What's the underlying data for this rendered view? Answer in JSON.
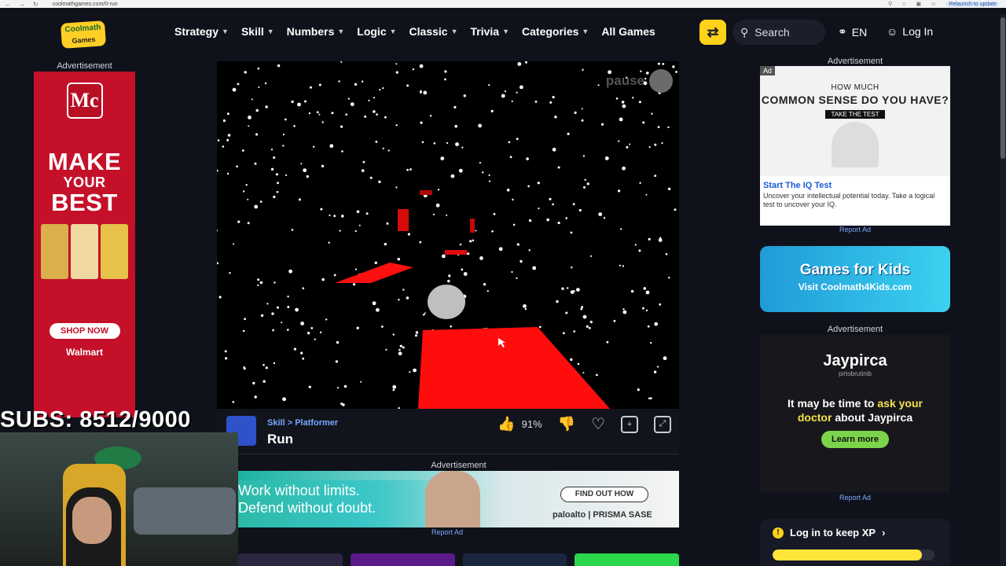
{
  "browser": {
    "url": "coolmathgames.com/0-run",
    "relaunch": "Relaunch to update"
  },
  "header": {
    "logo_line1": "Coolmath",
    "logo_line2": "Games",
    "menu": [
      {
        "label": "Strategy"
      },
      {
        "label": "Skill"
      },
      {
        "label": "Numbers"
      },
      {
        "label": "Logic"
      },
      {
        "label": "Classic"
      },
      {
        "label": "Trivia"
      },
      {
        "label": "Categories"
      }
    ],
    "all_games": "All Games",
    "search": "Search",
    "lang": "EN",
    "login": "Log In"
  },
  "left_ad": {
    "label": "Advertisement",
    "logo": "Mc",
    "headline_1": "MAKE",
    "headline_2": "YOUR",
    "headline_3": "BEST",
    "cta": "SHOP NOW",
    "retailer": "Walmart"
  },
  "overlay": {
    "subs": "SUBS: 8512/9000"
  },
  "game": {
    "pause": "pause",
    "breadcrumb_category": "Skill",
    "breadcrumb_sep": ">",
    "breadcrumb_sub": "Platformer",
    "title": "Run",
    "rating": "91%"
  },
  "mid_ad": {
    "label": "Advertisement",
    "line1": "Work without limits.",
    "line2": "Defend without doubt.",
    "cta": "FIND OUT HOW",
    "brand": "paloalto  |  PRISMA SASE",
    "report": "Report Ad"
  },
  "right_ad1": {
    "label": "Advertisement",
    "tag": "Ad",
    "h1": "HOW MUCH",
    "h2": "COMMON SENSE DO YOU HAVE?",
    "take": "TAKE THE TEST",
    "link": "Start The IQ Test",
    "desc": "Uncover your intellectual potential today. Take a logical test to uncover your IQ.",
    "report": "Report Ad"
  },
  "kids": {
    "title": "Games for Kids",
    "sub": "Visit Coolmath4Kids.com"
  },
  "right_ad2": {
    "label": "Advertisement",
    "brand": "Jaypirca",
    "brand_sub": "pirtobrutinib",
    "msg_1": "It may be time to",
    "msg_2": "ask your",
    "msg_3": "doctor",
    "msg_4": "about Jaypirca",
    "cta": "Learn more",
    "report": "Report Ad"
  },
  "xp": {
    "text": "Log in to keep XP",
    "progress_fraction": 0.92
  },
  "colors": {
    "accent_yellow": "#ffd21a",
    "link_blue": "#74a9ff",
    "platform_red": "#ff0d0d",
    "background": "#10121b"
  }
}
